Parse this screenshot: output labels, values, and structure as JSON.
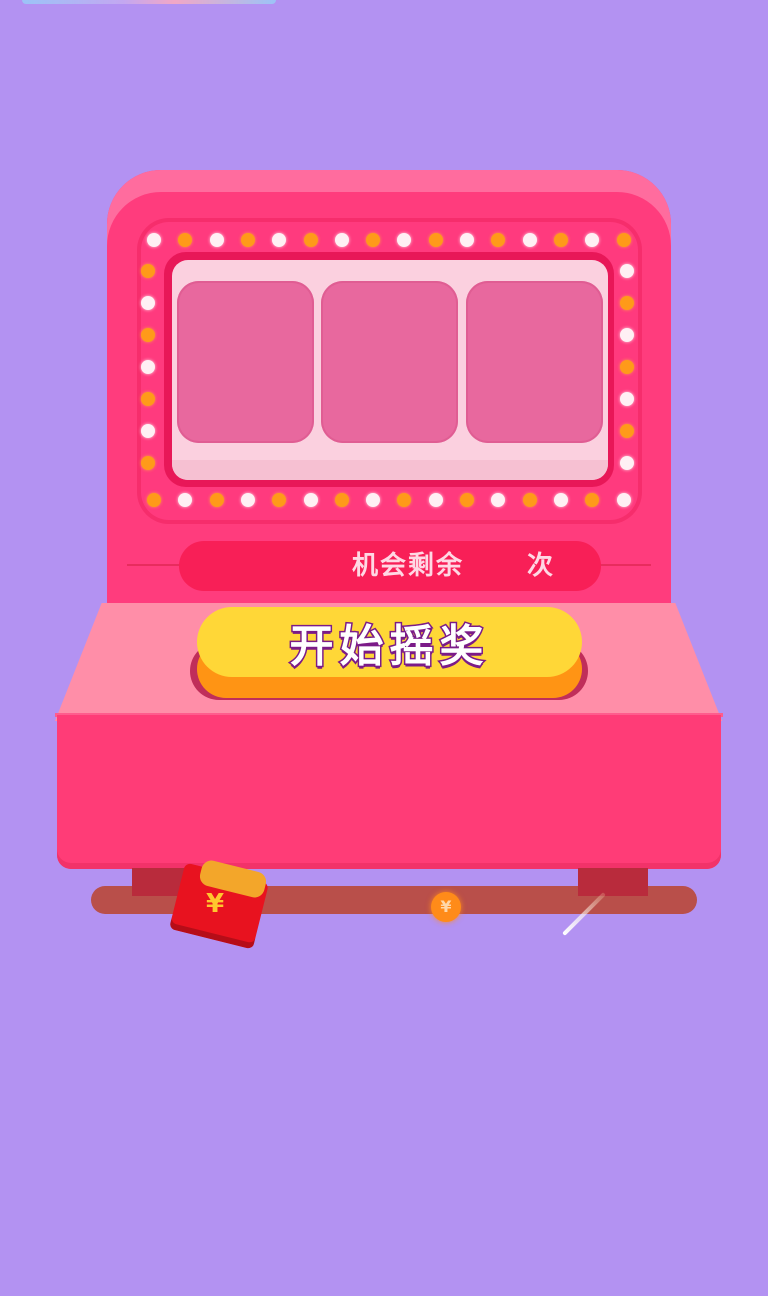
{
  "game": {
    "chances_label": "机会剩余",
    "chances_count": "",
    "chances_unit": "次",
    "start_button_label": "开始摇奖",
    "reels": [
      {
        "symbol": ""
      },
      {
        "symbol": ""
      },
      {
        "symbol": ""
      }
    ]
  },
  "decor": {
    "currency_symbol": "¥"
  },
  "colors": {
    "background": "#b392f2",
    "machine_pink": "#ff3c7d",
    "button_yellow": "#ffd737",
    "button_outline": "#7b1b88"
  }
}
